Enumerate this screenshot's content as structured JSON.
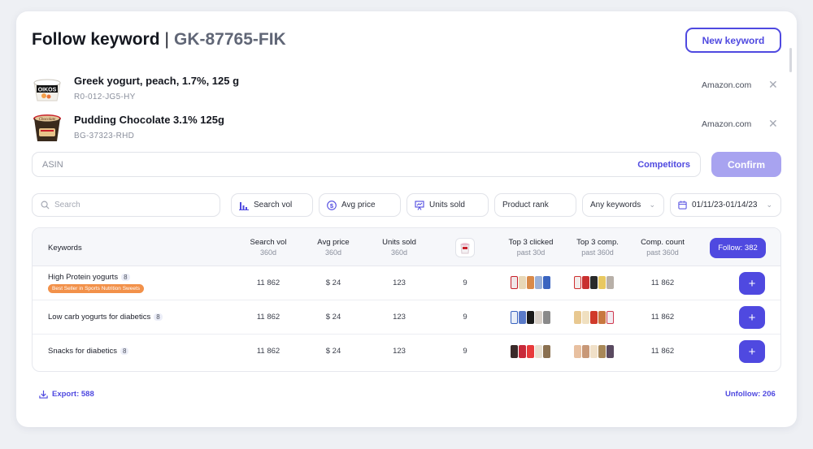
{
  "header": {
    "title": "Follow keyword",
    "separator": "|",
    "code": "GK-87765-FIK",
    "new_keyword_label": "New keyword"
  },
  "products": [
    {
      "name": "Greek yogurt, peach, 1.7%, 125 g",
      "sku": "R0-012-JG5-HY",
      "store": "Amazon.com",
      "thumb_color": "#f5f2ec",
      "thumb_accent": "#1a1a1a"
    },
    {
      "name": "Pudding Chocolate 3.1% 125g",
      "sku": "BG-37323-RHD",
      "store": "Amazon.com",
      "thumb_color": "#3a2a1c",
      "thumb_accent": "#c8202a"
    }
  ],
  "asin": {
    "placeholder": "ASIN",
    "competitors_label": "Competitors",
    "confirm_label": "Confirm"
  },
  "filters": {
    "search_placeholder": "Search",
    "search_vol": "Search vol",
    "avg_price": "Avg price",
    "units_sold": "Units sold",
    "product_rank": "Product rank",
    "any_keywords": "Any keywords",
    "date_range": "01/11/23-01/14/23"
  },
  "table": {
    "headers": {
      "keywords": "Keywords",
      "search_vol": "Search vol",
      "search_vol_sub": "360d",
      "avg_price": "Avg price",
      "avg_price_sub": "360d",
      "units_sold": "Units sold",
      "units_sold_sub": "360d",
      "top3_clicked": "Top 3 clicked",
      "top3_clicked_sub": "past 30d",
      "top3_comp": "Top 3 comp.",
      "top3_comp_sub": "past 360d",
      "comp_count": "Comp. count",
      "comp_count_sub": "past 360d",
      "follow_label": "Follow: 382"
    },
    "rows": [
      {
        "keyword": "High Protein yogurts",
        "count": "8",
        "badge": "Best Seller in Sports Nutrition Sweets",
        "search_vol": "11 862",
        "avg_price": "$ 24",
        "units_sold": "123",
        "rank": "9",
        "comp_count": "11 862"
      },
      {
        "keyword": "Low carb yogurts for diabetics",
        "count": "8",
        "badge": "",
        "search_vol": "11 862",
        "avg_price": "$ 24",
        "units_sold": "123",
        "rank": "9",
        "comp_count": "11 862"
      },
      {
        "keyword": "Snacks for diabetics",
        "count": "8",
        "badge": "",
        "search_vol": "11 862",
        "avg_price": "$ 24",
        "units_sold": "123",
        "rank": "9",
        "comp_count": "11 862"
      }
    ]
  },
  "footer": {
    "export_label": "Export: 588",
    "unfollow_label": "Unfollow: 206"
  },
  "colors": {
    "accent": "#4f49e0",
    "accent_light": "#a8a3f0",
    "badge": "#f2914a"
  }
}
